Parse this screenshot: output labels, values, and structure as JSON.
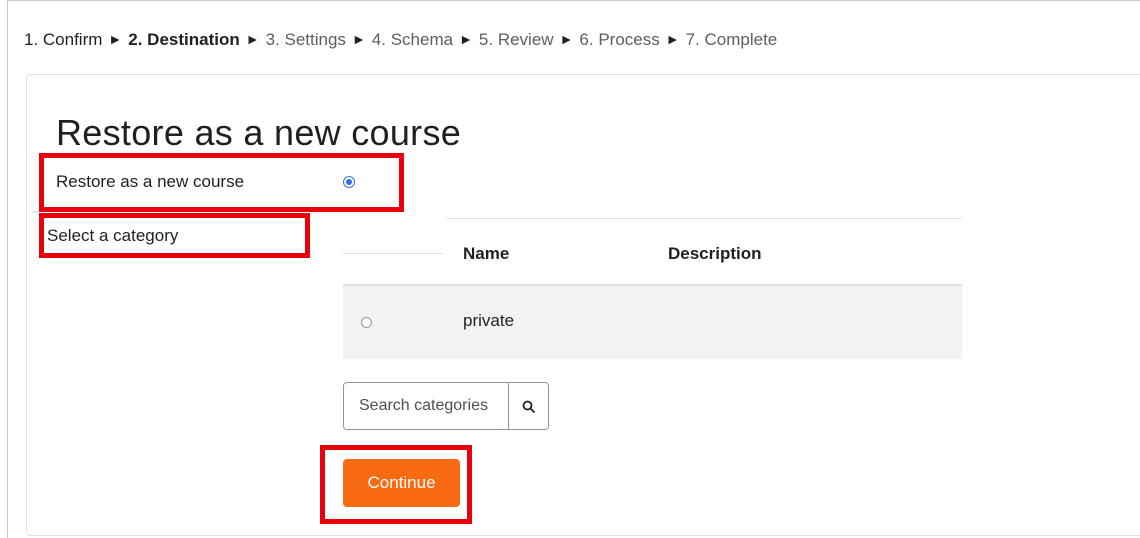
{
  "progress": {
    "steps": [
      {
        "label": "1. Confirm",
        "state": "done"
      },
      {
        "label": "2. Destination",
        "state": "current"
      },
      {
        "label": "3. Settings",
        "state": "upcoming"
      },
      {
        "label": "4. Schema",
        "state": "upcoming"
      },
      {
        "label": "5. Review",
        "state": "upcoming"
      },
      {
        "label": "6. Process",
        "state": "upcoming"
      },
      {
        "label": "7. Complete",
        "state": "upcoming"
      }
    ],
    "separator": "►"
  },
  "section": {
    "title": "Restore as a new course"
  },
  "form": {
    "restore_label": "Restore as a new course",
    "restore_selected": true,
    "category_label": "Select a category"
  },
  "category_table": {
    "headers": [
      "Name",
      "Description"
    ],
    "rows": [
      {
        "name": "private",
        "description": "",
        "selected": false
      }
    ]
  },
  "search": {
    "placeholder": "Search categories",
    "value": "",
    "button_icon": "search-icon"
  },
  "actions": {
    "continue_label": "Continue"
  },
  "colors": {
    "accent": "#f96b13",
    "radio": "#2f6fdf",
    "highlight": "#e8000b",
    "row_background": "#f2f2f2"
  }
}
